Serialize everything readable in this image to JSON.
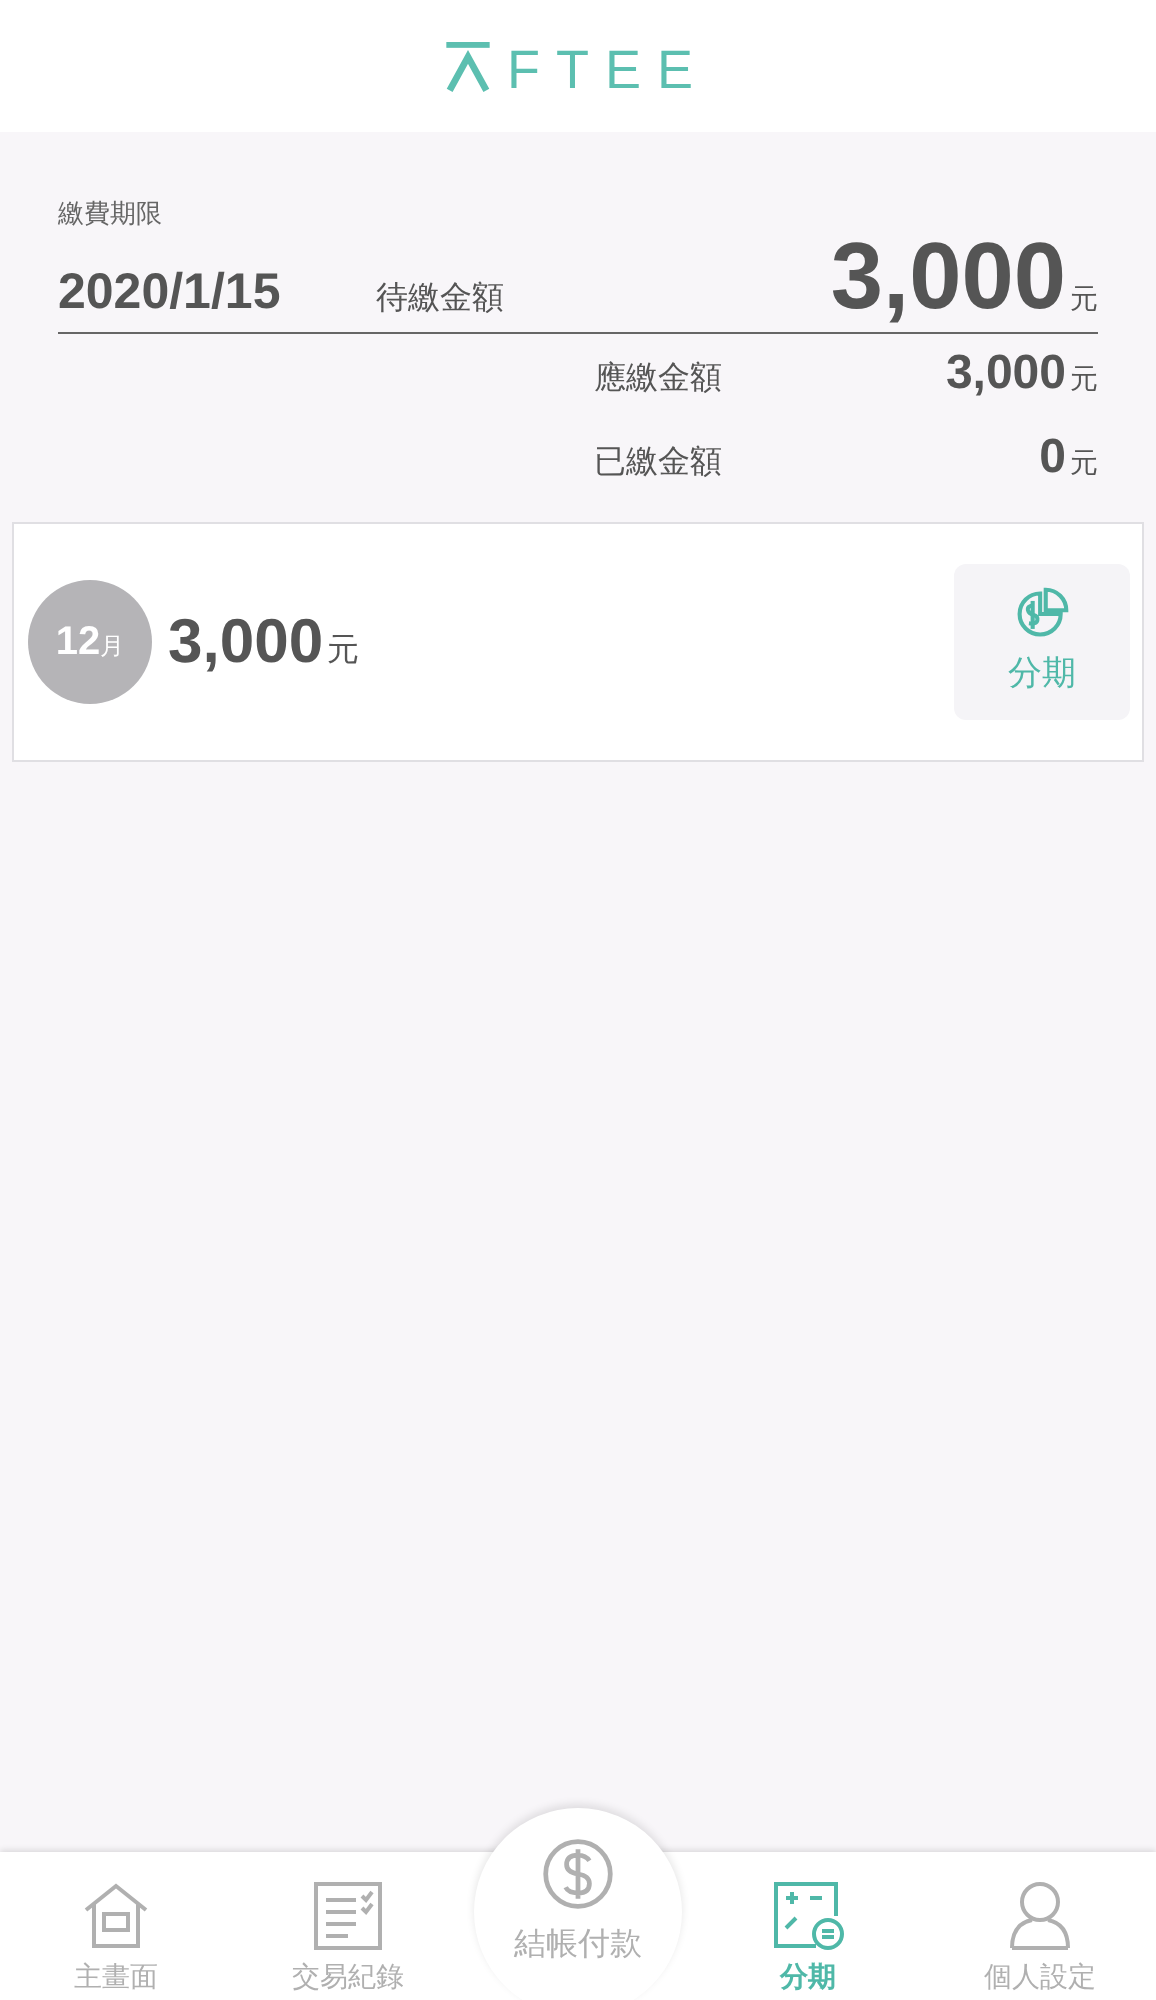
{
  "header": {
    "logo": "FTEE"
  },
  "summary": {
    "due_label": "繳費期限",
    "due_date": "2020/1/15",
    "pending_label": "待繳金額",
    "pending_amount": "3,000",
    "pending_unit": "元",
    "rows": [
      {
        "label": "應繳金額",
        "amount": "3,000",
        "unit": "元"
      },
      {
        "label": "已繳金額",
        "amount": "0",
        "unit": "元"
      }
    ]
  },
  "bills": [
    {
      "month": "12",
      "month_unit": "月",
      "amount": "3,000",
      "unit": "元",
      "action": "分期"
    }
  ],
  "nav": [
    {
      "kind": "home",
      "label": "主畫面",
      "selected": false
    },
    {
      "kind": "records",
      "label": "交易紀錄",
      "selected": false
    },
    {
      "kind": "pay",
      "label": "結帳付款",
      "selected": false
    },
    {
      "kind": "installment",
      "label": "分期",
      "selected": true
    },
    {
      "kind": "profile",
      "label": "個人設定",
      "selected": false
    }
  ]
}
